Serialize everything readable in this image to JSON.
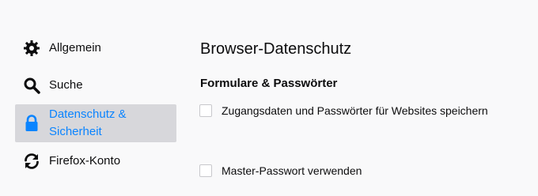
{
  "sidebar": {
    "items": [
      {
        "label": "Allgemein",
        "icon": "gear-icon"
      },
      {
        "label": "Suche",
        "icon": "search-icon"
      },
      {
        "label": "Datenschutz & Sicherheit",
        "icon": "lock-icon",
        "selected": true
      },
      {
        "label": "Firefox-Konto",
        "icon": "sync-icon"
      }
    ]
  },
  "main": {
    "title": "Browser-Datenschutz",
    "section_title": "Formulare & Passwörter",
    "options": [
      {
        "label": "Zugangsdaten und Passwörter für Websites speichern",
        "checked": false
      },
      {
        "label": "Master-Passwort verwenden",
        "checked": false
      }
    ]
  },
  "colors": {
    "accent": "#0a84ff",
    "selected_background": "#d7d7db",
    "page_background": "#f9f9fa",
    "text": "#0c0c0d"
  }
}
